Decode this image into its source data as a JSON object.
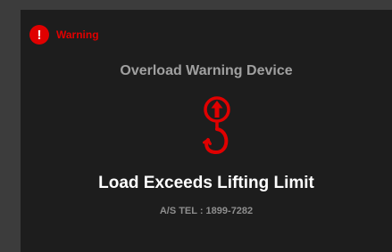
{
  "header": {
    "badge_glyph": "!",
    "warning_label": "Warning"
  },
  "device_title": "Overload Warning Device",
  "hook_icon": "crane-hook-icon",
  "alert_message": "Load Exceeds Lifting Limit",
  "contact": {
    "as_tel": "A/S TEL : 1899-7282"
  },
  "colors": {
    "accent": "#e00000",
    "panel_bg": "#1d1d1d",
    "outer_bg": "#3c3c3c",
    "title_text": "#a0a0a0",
    "message_text": "#ffffff",
    "contact_text": "#8e8e8e"
  }
}
